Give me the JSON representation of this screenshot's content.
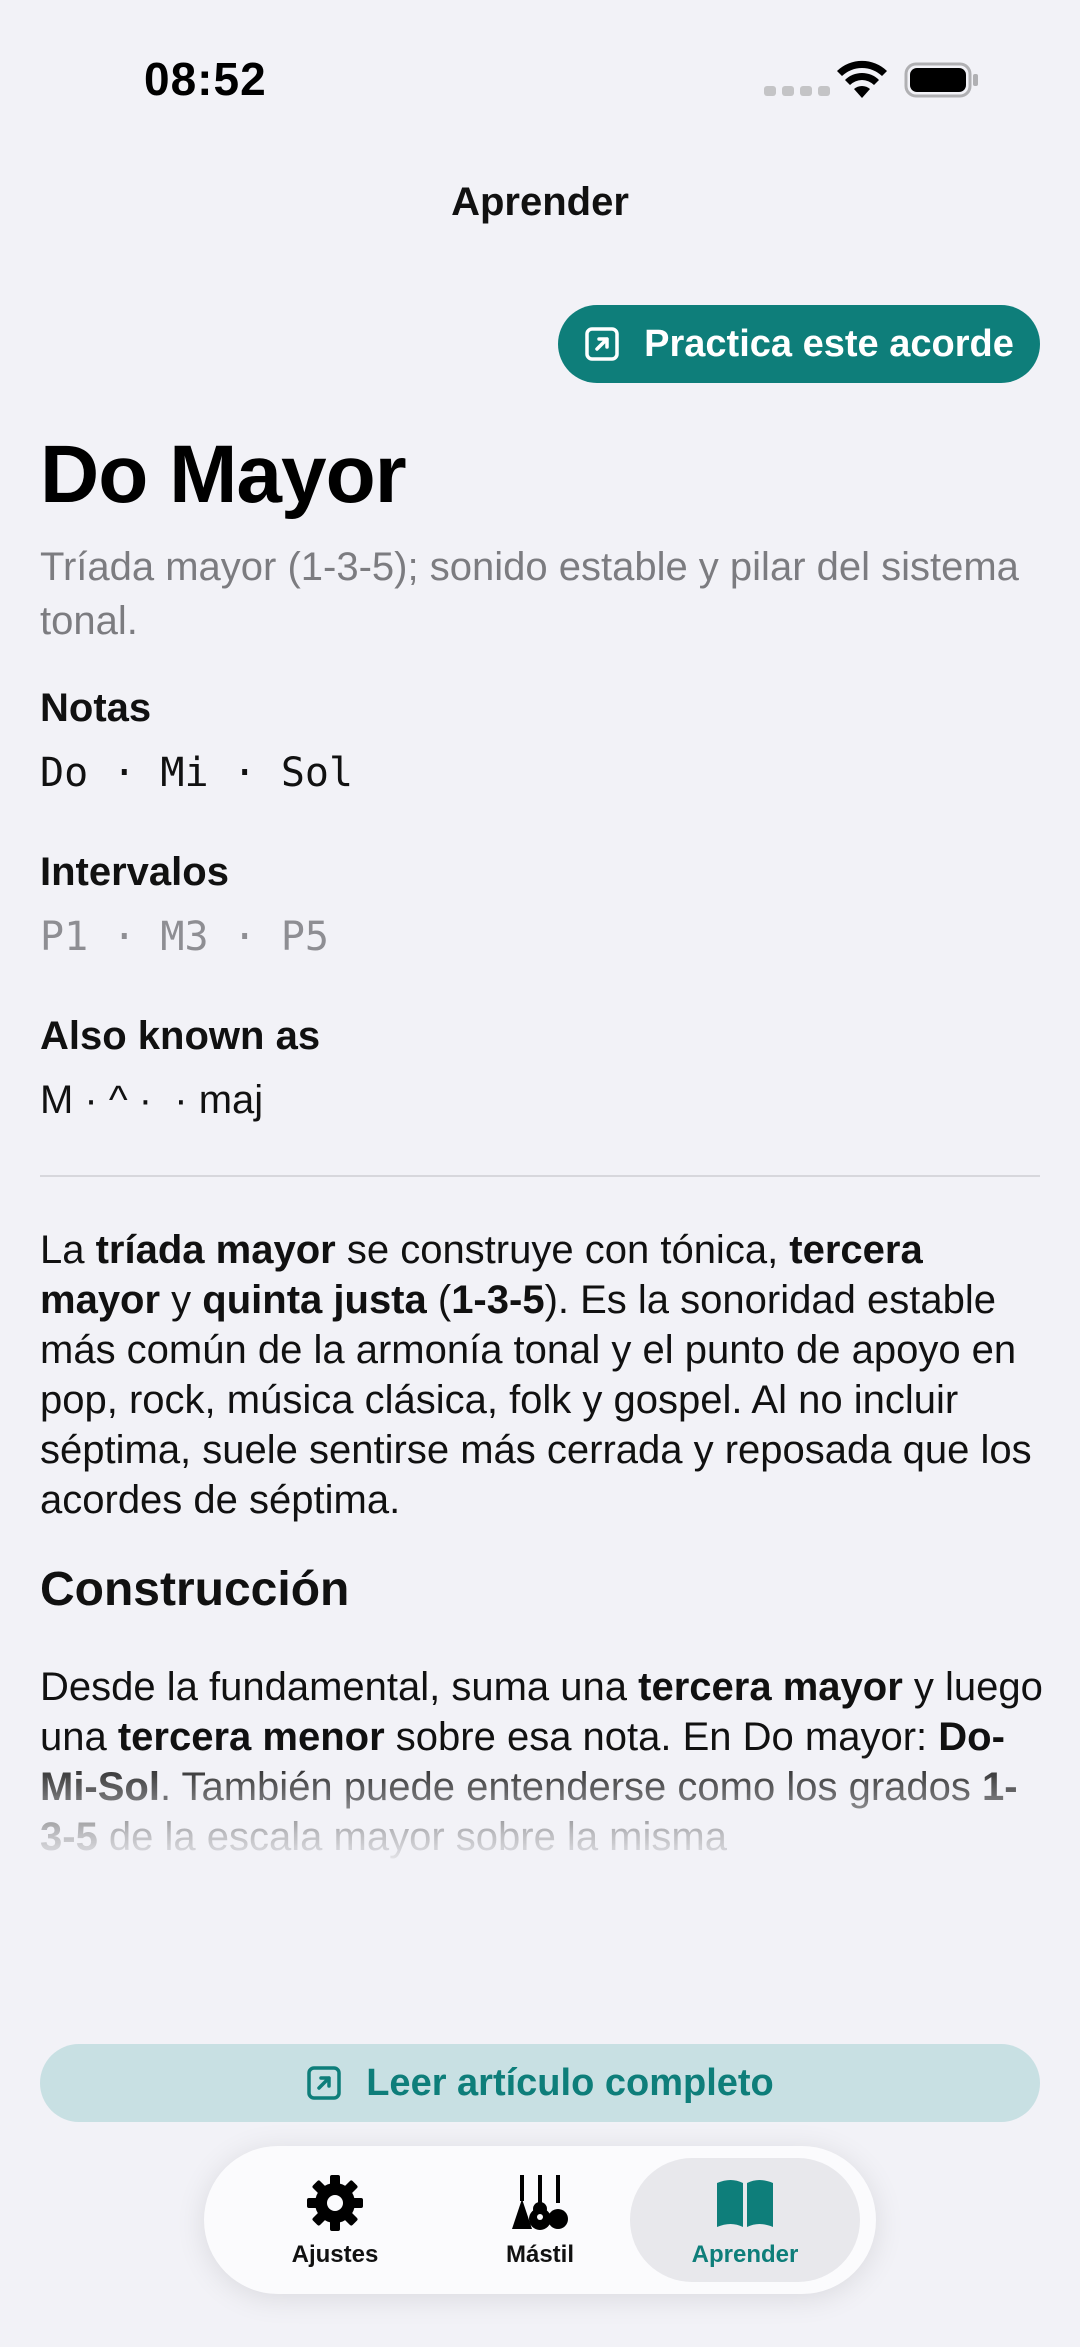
{
  "status_bar": {
    "time": "08:52"
  },
  "nav": {
    "title": "Aprender"
  },
  "practice_button": {
    "label": "Practica este acorde"
  },
  "chord": {
    "name": "Do Mayor",
    "subtitle": "Tríada mayor (1-3-5); sonido estable y pilar del sistema tonal.",
    "notes_label": "Notas",
    "notes": "Do · Mi · Sol",
    "intervals_label": "Intervalos",
    "intervals": "P1 · M3 · P5",
    "aka_label": "Also known as",
    "aka": "M · ^ ·  · maj"
  },
  "article": {
    "intro": [
      {
        "t": "La "
      },
      {
        "t": "tríada mayor",
        "b": true
      },
      {
        "t": " se construye con tónica, "
      },
      {
        "t": "tercera mayor",
        "b": true
      },
      {
        "t": " y "
      },
      {
        "t": "quinta justa",
        "b": true
      },
      {
        "t": " ("
      },
      {
        "t": "1-3-5",
        "b": true
      },
      {
        "t": "). Es la sonoridad estable más común de la armonía tonal y el punto de apoyo en pop, rock, música clásica, folk y gospel. Al no incluir séptima, suele sentirse más cerrada y reposada que los acordes de séptima."
      }
    ],
    "construction_heading": "Construcción",
    "construction": [
      {
        "t": "Desde la fundamental, suma una "
      },
      {
        "t": "tercera mayor",
        "b": true
      },
      {
        "t": " y luego una "
      },
      {
        "t": "tercera menor",
        "b": true
      },
      {
        "t": " sobre esa nota. En Do mayor: "
      },
      {
        "t": "Do-Mi-Sol",
        "b": true
      },
      {
        "t": ". También puede entenderse como los grados "
      },
      {
        "t": "1-3-5",
        "b": true
      },
      {
        "t": " de la escala mayor sobre la misma"
      }
    ]
  },
  "read_button": {
    "label": "Leer artículo completo"
  },
  "tabs": [
    {
      "label": "Ajustes",
      "icon": "gear-icon",
      "active": false
    },
    {
      "label": "Mástil",
      "icon": "guitars-icon",
      "active": false
    },
    {
      "label": "Aprender",
      "icon": "book-icon",
      "active": true
    }
  ],
  "colors": {
    "accent": "#0e7e7a",
    "accent_light": "#c8e0e3",
    "background": "#f2f2f7",
    "secondary_text": "#7c7c80"
  }
}
